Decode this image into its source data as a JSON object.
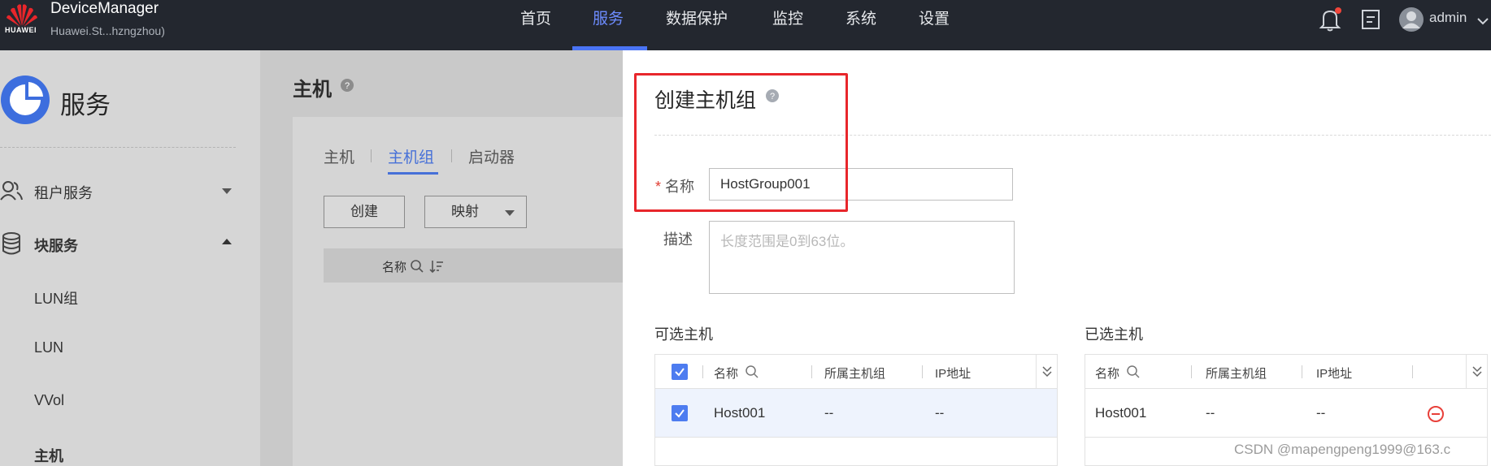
{
  "header": {
    "brand": "HUAWEI",
    "app_title": "DeviceManager",
    "device": "Huawei.St...hzngzhou)",
    "nav": [
      "首页",
      "服务",
      "数据保护",
      "监控",
      "系统",
      "设置"
    ],
    "active_nav": "服务",
    "user": "admin",
    "accent_color": "#4a74f5"
  },
  "sidebar": {
    "title": "服务",
    "groups": [
      {
        "label": "租户服务",
        "expanded": false
      },
      {
        "label": "块服务",
        "expanded": true
      }
    ],
    "items": [
      "LUN组",
      "LUN",
      "VVol",
      "主机"
    ]
  },
  "main": {
    "title": "主机",
    "tabs": [
      "主机",
      "主机组",
      "启动器"
    ],
    "active_tab": "主机组",
    "buttons": {
      "create": "创建",
      "map": "映射"
    },
    "table_header": "名称"
  },
  "dialog": {
    "title": "创建主机组",
    "name_label": "名称",
    "name_value": "HostGroup001",
    "desc_label": "描述",
    "desc_placeholder": "长度范围是0到63位。",
    "available": {
      "label": "可选主机",
      "headers": [
        "名称",
        "所属主机组",
        "IP地址"
      ],
      "rows": [
        {
          "name": "Host001",
          "group": "--",
          "ip": "--",
          "checked": true
        }
      ]
    },
    "selected": {
      "label": "已选主机",
      "headers": [
        "名称",
        "所属主机组",
        "IP地址"
      ],
      "rows": [
        {
          "name": "Host001",
          "group": "--",
          "ip": "--"
        }
      ]
    }
  },
  "watermark": "CSDN @mapengpeng1999@163.c"
}
